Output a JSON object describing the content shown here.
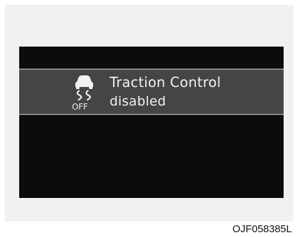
{
  "display": {
    "icon": "traction-control-off-icon",
    "icon_off_label": "OFF",
    "message_title": "Traction Control",
    "message_subtitle": "disabled"
  },
  "reference_code": "OJF058385L",
  "colors": {
    "screen": "#0c0c0c",
    "banner": "#454545",
    "banner_border": "#8a8a8a",
    "text": "#f2f2f2",
    "frame": "#f1f1f1"
  }
}
